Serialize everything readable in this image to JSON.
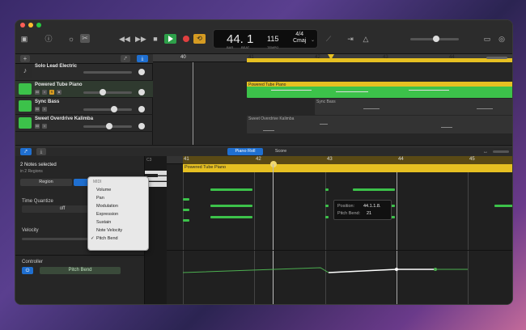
{
  "colors": {
    "accent": "#1f6fd0",
    "play": "#2ea04a",
    "cycle": "#d59b22",
    "region_yellow": "#e6c022",
    "note_green": "#3cc24a"
  },
  "lcd": {
    "position": "44. 1",
    "tempo": "115",
    "time_signature": "4/4",
    "key": "Cmaj",
    "label_bar": "BAR",
    "label_beat": "BEAT",
    "label_tempo": "TEMPO"
  },
  "ruler": {
    "bars": [
      "40",
      "41",
      "42",
      "43",
      "44"
    ]
  },
  "tracks": [
    {
      "name": "Solo Lead Electric",
      "color": "#7a6ad0"
    },
    {
      "name": "Powered Tube Piano",
      "color": "#3cc24a"
    },
    {
      "name": "Sync Bass",
      "color": "#3a3a3a"
    },
    {
      "name": "Sweet Overdrive Kalimba",
      "color": "#3cc24a"
    }
  ],
  "regions": {
    "piano": "Powered Tube Piano",
    "bass": "Sync Bass",
    "kalimba": "Sweet Overdrive Kalimba"
  },
  "editor": {
    "tab_piano_roll": "Piano Roll",
    "tab_score": "Score",
    "selection": "2 Notes selected",
    "selection_sub": "in 2 Regions",
    "tab_region": "Region",
    "tab_notes": "Notes",
    "time_quantize_label": "Time Quantize",
    "time_quantize_value": "off",
    "velocity_label": "Velocity",
    "controller_label": "Controller",
    "controller_value": "Pitch Bend",
    "ruler_bars": [
      "41",
      "42",
      "43",
      "44",
      "45"
    ],
    "region_label": "Powered Tube Piano",
    "key_label": "C3"
  },
  "menu": {
    "header": "MIDI",
    "items": [
      "Volume",
      "Pan",
      "Modulation",
      "Expression",
      "Sustain",
      "Note Velocity",
      "Pitch Bend"
    ],
    "checked": "Pitch Bend"
  },
  "tooltip": {
    "position_label": "Position:",
    "position_value": "44.1.1.8.",
    "bend_label": "Pitch Bend:",
    "bend_value": "21"
  }
}
